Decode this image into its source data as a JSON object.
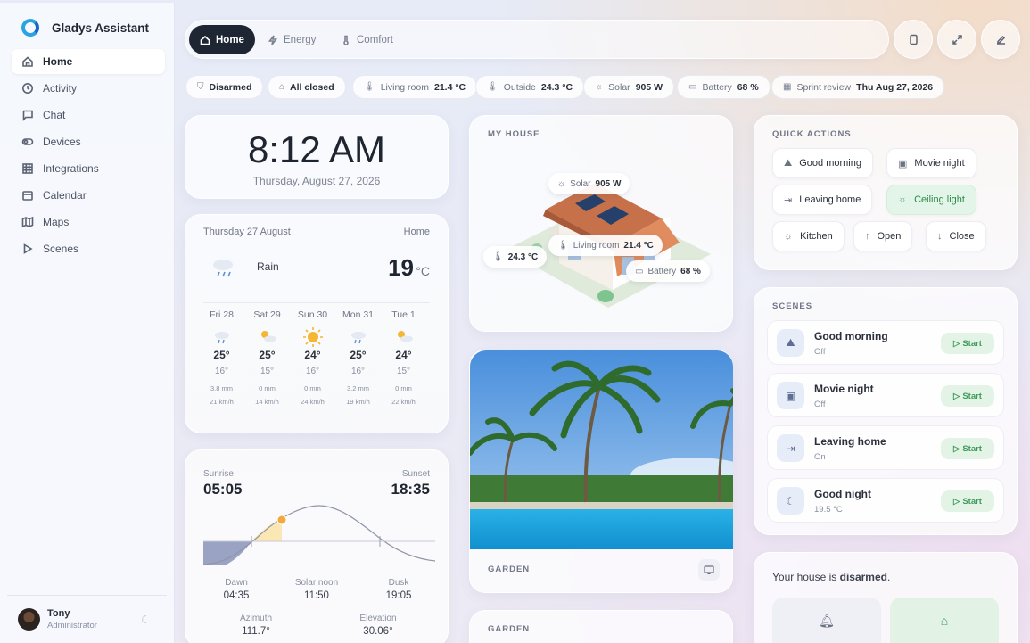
{
  "app": {
    "name": "Gladys Assistant"
  },
  "sidebar": {
    "items": [
      {
        "label": "Home",
        "icon": "home-icon",
        "active": true
      },
      {
        "label": "Activity",
        "icon": "clock-icon"
      },
      {
        "label": "Chat",
        "icon": "chat-icon"
      },
      {
        "label": "Devices",
        "icon": "toggle-icon"
      },
      {
        "label": "Integrations",
        "icon": "grid-icon"
      },
      {
        "label": "Calendar",
        "icon": "calendar-icon"
      },
      {
        "label": "Maps",
        "icon": "map-icon"
      },
      {
        "label": "Scenes",
        "icon": "play-icon"
      }
    ],
    "user": {
      "name": "Tony",
      "role": "Administrator"
    }
  },
  "topbar": {
    "tabs": [
      {
        "label": "Home",
        "icon": "home-icon",
        "active": true
      },
      {
        "label": "Energy",
        "icon": "bolt-icon"
      },
      {
        "label": "Comfort",
        "icon": "thermometer-icon"
      }
    ]
  },
  "status_chips": [
    {
      "label": "Disarmed",
      "value": ""
    },
    {
      "label": "All closed",
      "value": ""
    },
    {
      "label": "Living room",
      "value": "21.4 °C"
    },
    {
      "label": "Outside",
      "value": "24.3 °C"
    },
    {
      "label": "Solar",
      "value": "905 W"
    },
    {
      "label": "Battery",
      "value": "68 %"
    },
    {
      "label": "Sprint review",
      "value": "Thu Aug 27, 2026"
    }
  ],
  "clock": {
    "time": "8:12 AM",
    "date": "Thursday, August 27, 2026"
  },
  "weather": {
    "date": "Thursday 27 August",
    "location": "Home",
    "condition": "Rain",
    "temperature": "19",
    "unit": "°C",
    "forecast": [
      {
        "day": "Fri 28",
        "icon": "rain-icon",
        "high": "25°",
        "low": "16°",
        "precip": "3.8 mm",
        "wind": "21 km/h"
      },
      {
        "day": "Sat 29",
        "icon": "partly-cloudy-icon",
        "high": "25°",
        "low": "15°",
        "precip": "0 mm",
        "wind": "14 km/h"
      },
      {
        "day": "Sun 30",
        "icon": "sun-icon",
        "high": "24°",
        "low": "16°",
        "precip": "0 mm",
        "wind": "24 km/h"
      },
      {
        "day": "Mon 31",
        "icon": "rain-icon",
        "high": "25°",
        "low": "16°",
        "precip": "3.2 mm",
        "wind": "19 km/h"
      },
      {
        "day": "Tue 1",
        "icon": "partly-cloudy-icon",
        "high": "24°",
        "low": "15°",
        "precip": "0 mm",
        "wind": "22 km/h"
      }
    ]
  },
  "sun": {
    "sunrise_label": "Sunrise",
    "sunrise": "05:05",
    "sunset_label": "Sunset",
    "sunset": "18:35",
    "dawn_label": "Dawn",
    "dawn": "04:35",
    "noon_label": "Solar noon",
    "noon": "11:50",
    "dusk_label": "Dusk",
    "dusk": "19:05",
    "azimuth_label": "Azimuth",
    "azimuth": "111.7°",
    "elevation_label": "Elevation",
    "elevation": "30.06°"
  },
  "house": {
    "title": "MY HOUSE",
    "solar_label": "Solar",
    "solar": "905 W",
    "outside": "24.3 °C",
    "living_label": "Living room",
    "living": "21.4 °C",
    "battery_label": "Battery",
    "battery": "68 %"
  },
  "garden": {
    "title": "GARDEN",
    "title2": "GARDEN"
  },
  "quick_actions": {
    "title": "QUICK ACTIONS",
    "items": [
      {
        "label": "Good morning",
        "icon": "sunrise-icon"
      },
      {
        "label": "Movie night",
        "icon": "film-icon"
      },
      {
        "label": "Leaving home",
        "icon": "exit-icon"
      },
      {
        "label": "Ceiling light",
        "icon": "light-icon",
        "active": true
      },
      {
        "label": "Kitchen",
        "icon": "light-icon"
      },
      {
        "label": "Open",
        "icon": "arrow-up-icon"
      },
      {
        "label": "Close",
        "icon": "arrow-down-icon"
      }
    ]
  },
  "scenes": {
    "title": "SCENES",
    "start_label": "Start",
    "items": [
      {
        "name": "Good morning",
        "state": "Off",
        "icon": "sunrise-icon"
      },
      {
        "name": "Movie night",
        "state": "Off",
        "icon": "film-icon"
      },
      {
        "name": "Leaving home",
        "state": "On",
        "icon": "exit-icon"
      },
      {
        "name": "Good night",
        "state": "19.5 °C",
        "icon": "moon-icon"
      }
    ]
  },
  "alarm": {
    "text_prefix": "Your house is ",
    "status": "disarmed",
    "text_suffix": "."
  },
  "colors": {
    "accent": "#1f2633",
    "green": "#3e9a5a",
    "brand": "#2aa3e4"
  }
}
